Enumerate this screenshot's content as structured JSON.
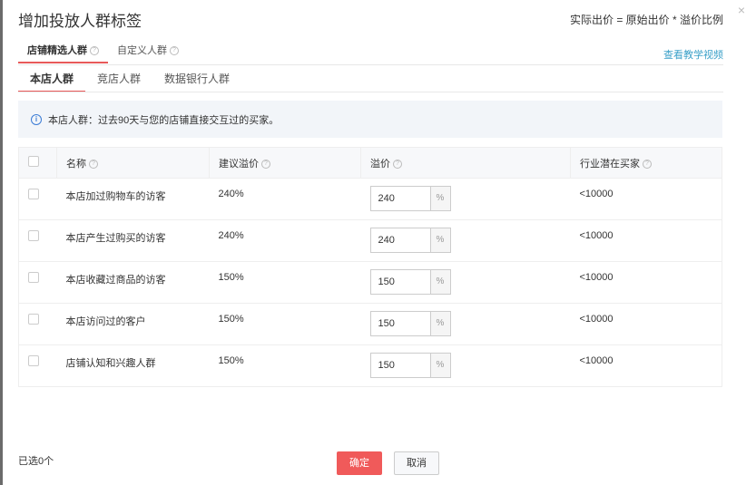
{
  "dialog": {
    "title": "增加投放人群标签",
    "formula": "实际出价 = 原始出价 * 溢价比例",
    "close": "×"
  },
  "tabs_primary": [
    {
      "label": "店铺精选人群"
    },
    {
      "label": "自定义人群"
    }
  ],
  "help": "?",
  "video_link": "查看教学视频",
  "tabs_secondary": [
    {
      "label": "本店人群"
    },
    {
      "label": "竞店人群"
    },
    {
      "label": "数据银行人群"
    }
  ],
  "info": {
    "icon": "i",
    "text": "本店人群：过去90天与您的店铺直接交互过的买家。"
  },
  "table": {
    "headers": [
      "名称",
      "建议溢价",
      "溢价",
      "行业潜在买家"
    ],
    "rows": [
      {
        "name": "本店加过购物车的访客",
        "suggested": "240%",
        "premium": "240",
        "unit": "%",
        "buyers": "<10000"
      },
      {
        "name": "本店产生过购买的访客",
        "suggested": "240%",
        "premium": "240",
        "unit": "%",
        "buyers": "<10000"
      },
      {
        "name": "本店收藏过商品的访客",
        "suggested": "150%",
        "premium": "150",
        "unit": "%",
        "buyers": "<10000"
      },
      {
        "name": "本店访问过的客户",
        "suggested": "150%",
        "premium": "150",
        "unit": "%",
        "buyers": "<10000"
      },
      {
        "name": "店铺认知和兴趣人群",
        "suggested": "150%",
        "premium": "150",
        "unit": "%",
        "buyers": "<10000"
      }
    ]
  },
  "footer": {
    "selected": "已选0个",
    "ok": "确定",
    "cancel": "取消"
  }
}
